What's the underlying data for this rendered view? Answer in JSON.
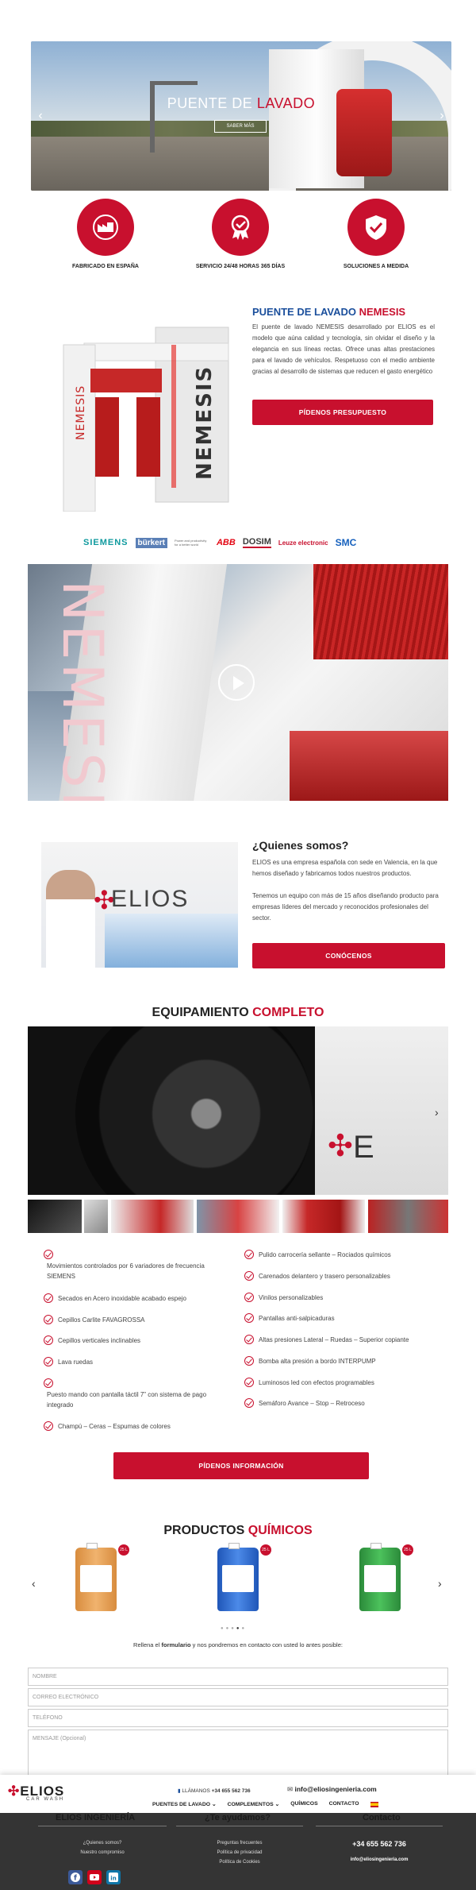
{
  "hero": {
    "title_white": "PUENTE DE ",
    "title_red": "LAVADO",
    "button": "SABER MÁS",
    "prev": "‹",
    "next": "›"
  },
  "features": [
    {
      "label": "FABRICADO EN ESPAÑA",
      "icon": "factory-icon"
    },
    {
      "label": "SERVICIO 24/48 HORAS 365 DÍAS",
      "icon": "award-badge-icon"
    },
    {
      "label": "SOLUCIONES A MEDIDA",
      "icon": "shield-check-icon"
    }
  ],
  "nemesis": {
    "title_blue": "PUENTE DE LAVADO ",
    "title_red": "NEMESIS",
    "text": "El puente de lavado NEMESIS desarrollado por ELIOS es el modelo que aúna calidad y tecnología, sin olvidar el diseño y la elegancia en sus líneas rectas. Ofrece unas altas prestaciones para el lavado de vehículos. Respetuoso con el medio ambiente gracias al desarrollo de sistemas que reducen el gasto energético",
    "button": "PÍDENOS PRESUPUESTO",
    "machine_text": "NEMESIS"
  },
  "brands": [
    "SIEMENS",
    "bürkert",
    "Power and productivity for a better world",
    "ABB",
    "DOSIM",
    "Leuze electronic",
    "SMC"
  ],
  "quienes": {
    "title": "¿Quienes somos?",
    "p1": "ELIOS es una empresa española con sede en Valencia, en la que hemos diseñado y fabricamos todos nuestros productos.",
    "p2": "Tenemos un equipo con más de 15 años diseñando producto para empresas líderes del mercado y reconocidos profesionales del sector.",
    "button": "CONÓCENOS",
    "image_logo": "ELIOS"
  },
  "equipamiento": {
    "title_black": "EQUIPAMIENTO ",
    "title_red": "COMPLETO",
    "left": [
      "Movimientos controlados por 6 variadores de frecuencia SIEMENS",
      "Secados en Acero inoxidable acabado espejo",
      "Cepillos Carlite FAVAGROSSA",
      "Cepillos verticales inclinables",
      "Lava ruedas",
      "Puesto mando con pantalla táctil 7” con sistema de pago integrado",
      "Champú – Ceras – Espumas de colores"
    ],
    "right": [
      "Pulido carrocería sellante – Rociados químicos",
      "Carenados delantero y trasero personalizables",
      "Vinilos personalizables",
      "Pantallas anti-salpicaduras",
      "Altas presiones Lateral – Ruedas – Superior copiante",
      "Bomba alta presión a bordo INTERPUMP",
      "Luminosos led con efectos programables",
      "Semáforo Avance – Stop – Retroceso"
    ],
    "button": "PÍDENOS INFORMACIÓN"
  },
  "productos": {
    "title_black": "PRODUCTOS ",
    "title_red": "QUÍMICOS",
    "can_tag": "25 L",
    "cans": [
      {
        "color": "#e7a35a"
      },
      {
        "color": "#2f6fd8"
      },
      {
        "color": "#3aa84a"
      }
    ]
  },
  "form": {
    "intro_a": "Rellena el ",
    "intro_b": "formulario",
    "intro_c": " y nos pondremos en contacto con usted lo antes posible:",
    "name": "NOMBRE",
    "email": "CORREO ELECTRÓNICO",
    "phone": "TELÉFONO",
    "message": "MENSAJE (Opcional)"
  },
  "header": {
    "logo": "ELIOS",
    "logo_sub": "CAR WASH",
    "phone_label": "LLÁMANOS ",
    "phone": "+34 655 562 736",
    "email": "info@eliosingenieria.com",
    "nav": [
      "PUENTES DE LAVADO",
      "COMPLEMENTOS",
      "QUÍMICOS",
      "CONTACTO"
    ]
  },
  "footer": {
    "col1_title": "ELIOS INGENIERÍA",
    "col2_title": "¿Te ayudamos?",
    "col3_title": "Contacto",
    "col1_links": [
      "¿Quienes somos?",
      "Nuestro compromiso"
    ],
    "col2_links": [
      "Preguntas frecuentes",
      "Política de privacidad",
      "Política de Cookies"
    ],
    "phone": "+34 655 562 736",
    "email": "info@eliosingenieria.com",
    "colors": {
      "facebook": "#3b5998",
      "youtube": "#d0021b",
      "linkedin": "#0e76a8"
    }
  }
}
